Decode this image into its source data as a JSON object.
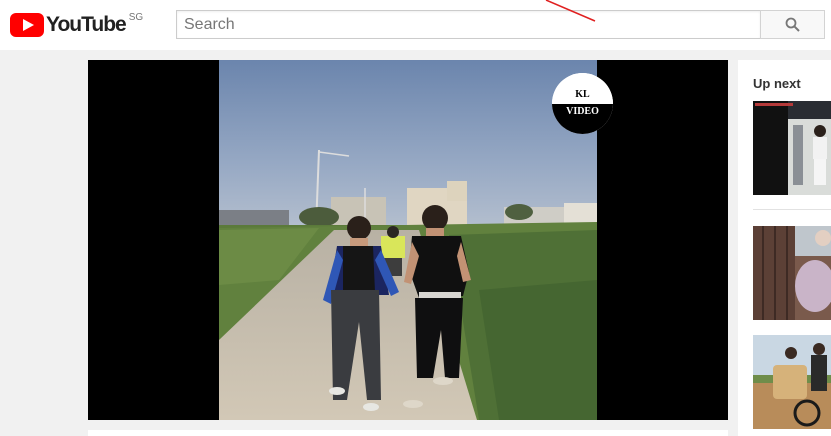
{
  "masthead": {
    "logo_text": "YouTube",
    "region": "SG",
    "search_placeholder": "Search"
  },
  "player": {
    "watermark_line1": "KL",
    "watermark_line2": "VIDEO"
  },
  "sidebar": {
    "up_next_label": "Up next",
    "thumbnails": [
      {
        "name": "up-next-video-1"
      },
      {
        "name": "up-next-video-2"
      },
      {
        "name": "up-next-video-3"
      }
    ]
  },
  "colors": {
    "brand_red": "#ff0000",
    "page_bg": "#f1f1f1",
    "annotation_red": "#e02020"
  }
}
